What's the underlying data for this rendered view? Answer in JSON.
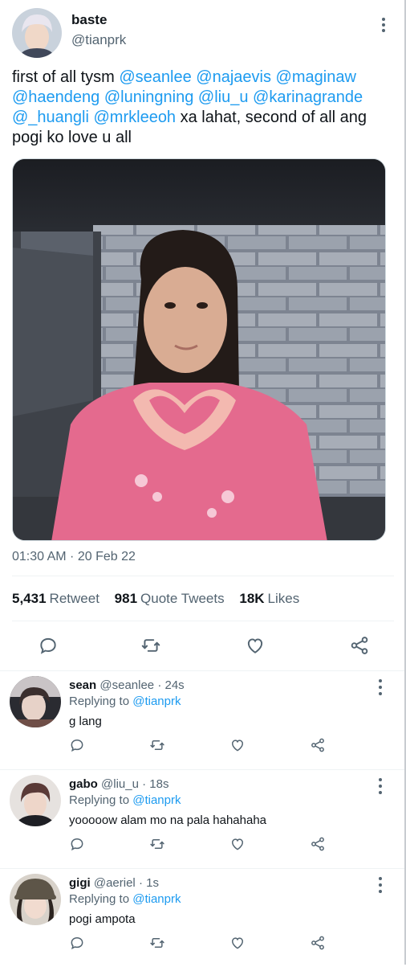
{
  "tweet": {
    "author": {
      "name": "baste",
      "handle": "@tianprk"
    },
    "text_segments": [
      {
        "text": "first of all tysm ",
        "mention": false
      },
      {
        "text": "@seanlee",
        "mention": true
      },
      {
        "text": " ",
        "mention": false
      },
      {
        "text": "@najaevis",
        "mention": true
      },
      {
        "text": " ",
        "mention": false
      },
      {
        "text": "@maginaw",
        "mention": true
      },
      {
        "text": " ",
        "mention": false
      },
      {
        "text": "@haendeng",
        "mention": true
      },
      {
        "text": " ",
        "mention": false
      },
      {
        "text": "@luningning",
        "mention": true
      },
      {
        "text": " ",
        "mention": false
      },
      {
        "text": "@liu_u",
        "mention": true
      },
      {
        "text": " ",
        "mention": false
      },
      {
        "text": "@karinagrande",
        "mention": true
      },
      {
        "text": " ",
        "mention": false
      },
      {
        "text": "@_huangli",
        "mention": true
      },
      {
        "text": " ",
        "mention": false
      },
      {
        "text": "@mrkleeoh",
        "mention": true
      },
      {
        "text": " xa lahat, second of all ang pogi ko love u all",
        "mention": false
      }
    ],
    "timestamp": "01:30 AM · 20 Feb 22",
    "stats": {
      "retweets_count": "5,431",
      "retweets_label": "Retweet",
      "quotes_count": "981",
      "quotes_label": "Quote Tweets",
      "likes_count": "18K",
      "likes_label": "Likes"
    }
  },
  "replies": [
    {
      "name": "sean",
      "handle": "@seanlee",
      "time": "· 24s",
      "replying_label": "Replying to",
      "replying_to": "@tianprk",
      "text": "g lang"
    },
    {
      "name": "gabo",
      "handle": "@liu_u",
      "time": "· 18s",
      "replying_label": "Replying to",
      "replying_to": "@tianprk",
      "text": "yooooow alam mo na pala hahahaha"
    },
    {
      "name": "gigi",
      "handle": "@aeriel",
      "time": "· 1s",
      "replying_label": "Replying to",
      "replying_to": "@tianprk",
      "text": "pogi ampota"
    }
  ],
  "icons": {
    "reply": "reply-icon",
    "retweet": "retweet-icon",
    "like": "heart-icon",
    "share": "share-icon",
    "more": "more-options-icon"
  },
  "colors": {
    "link": "#1d9bf0",
    "text": "#0f1419",
    "secondary": "#536471"
  }
}
